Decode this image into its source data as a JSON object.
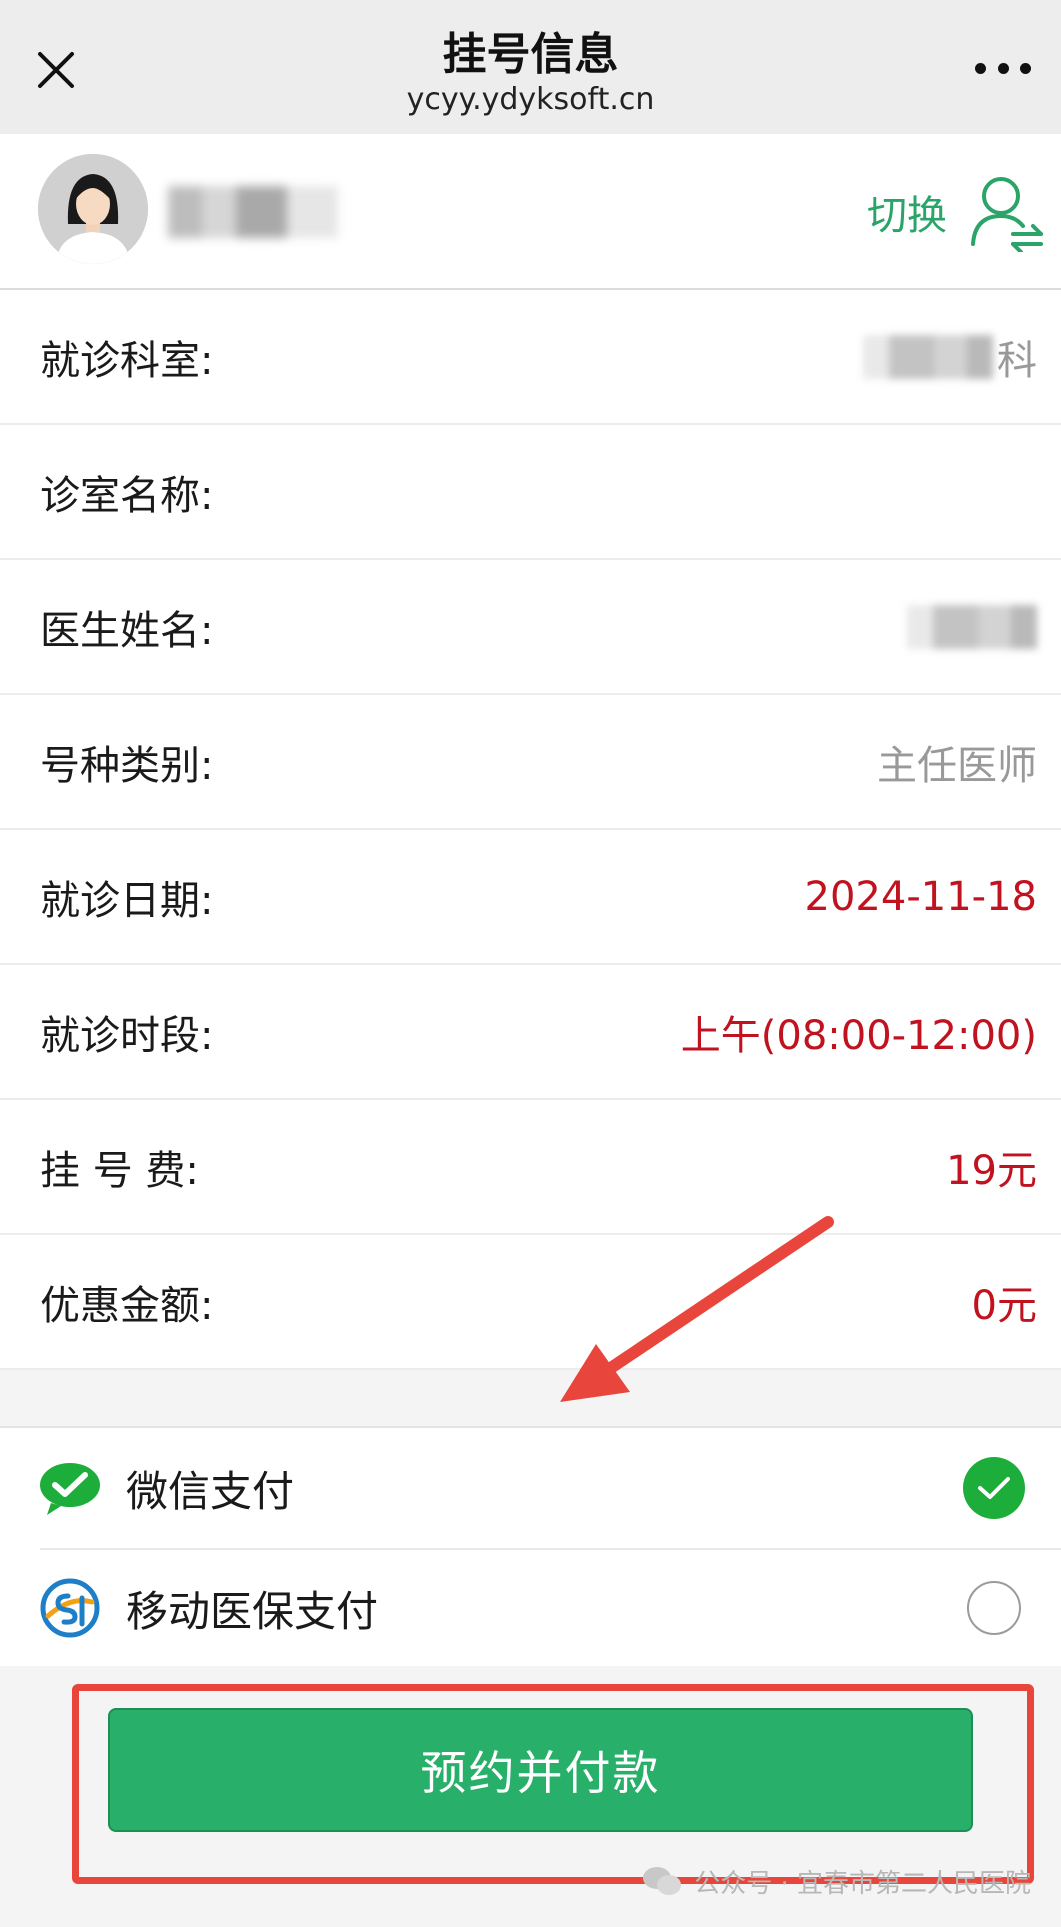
{
  "header": {
    "title": "挂号信息",
    "url": "ycyy.ydyksoft.cn",
    "close_icon": "close-icon",
    "more_icon": "more-dots-icon"
  },
  "patient": {
    "name": "",
    "switch_label": "切换",
    "avatar_icon": "avatar-female",
    "switch_icon": "user-switch-icon"
  },
  "info_rows": [
    {
      "label": "就诊科室:",
      "value": "科"
    },
    {
      "label": "诊室名称:",
      "value": ""
    },
    {
      "label": "医生姓名:",
      "value": ""
    },
    {
      "label": "号种类别:",
      "value": "主任医师"
    },
    {
      "label": "就诊日期:",
      "value": "2024-11-18"
    },
    {
      "label": "就诊时段:",
      "value": "上午(08:00-12:00)"
    },
    {
      "label": "挂 号 费:",
      "value": "19元"
    },
    {
      "label": "优惠金额:",
      "value": "0元"
    }
  ],
  "payment": {
    "options": [
      {
        "label": "微信支付",
        "selected": true,
        "icon": "wechat-pay-icon"
      },
      {
        "label": "移动医保支付",
        "selected": false,
        "icon": "medical-insurance-icon"
      }
    ]
  },
  "submit": {
    "label": "预约并付款"
  },
  "watermark": {
    "text": "公众号 · 宜春市第二人民医院"
  },
  "colors": {
    "accent_green": "#28b06b",
    "value_red": "#c1121f",
    "annotation_red": "#e8463c",
    "wechat_green": "#1dad3a"
  }
}
